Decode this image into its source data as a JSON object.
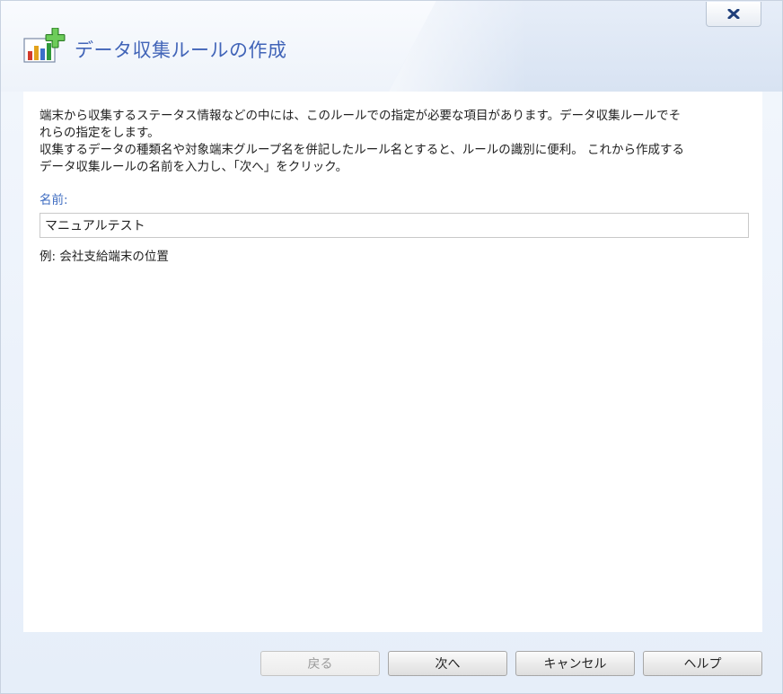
{
  "dialog": {
    "title": "データ収集ルールの作成",
    "close_icon": "close-x-icon",
    "app_icon": "chart-add-icon"
  },
  "content": {
    "description_lines": [
      "端末から収集するステータス情報などの中には、このルールでの指定が必要な項目があります。データ収集ルールでそ",
      "れらの指定をします。",
      "収集するデータの種類名や対象端末グループ名を併記したルール名とすると、ルールの識別に便利。 これから作成する",
      "データ収集ルールの名前を入力し、「次へ」をクリック。"
    ],
    "name_label": "名前:",
    "name_value": "マニュアルテスト",
    "example_text": "例: 会社支給端末の位置"
  },
  "buttons": {
    "back_label": "戻る",
    "next_label": "次へ",
    "cancel_label": "キャンセル",
    "help_label": "ヘルプ"
  },
  "colors": {
    "title": "#4164b8",
    "label": "#3d6bc0",
    "close_x": "#1f3f7a"
  }
}
